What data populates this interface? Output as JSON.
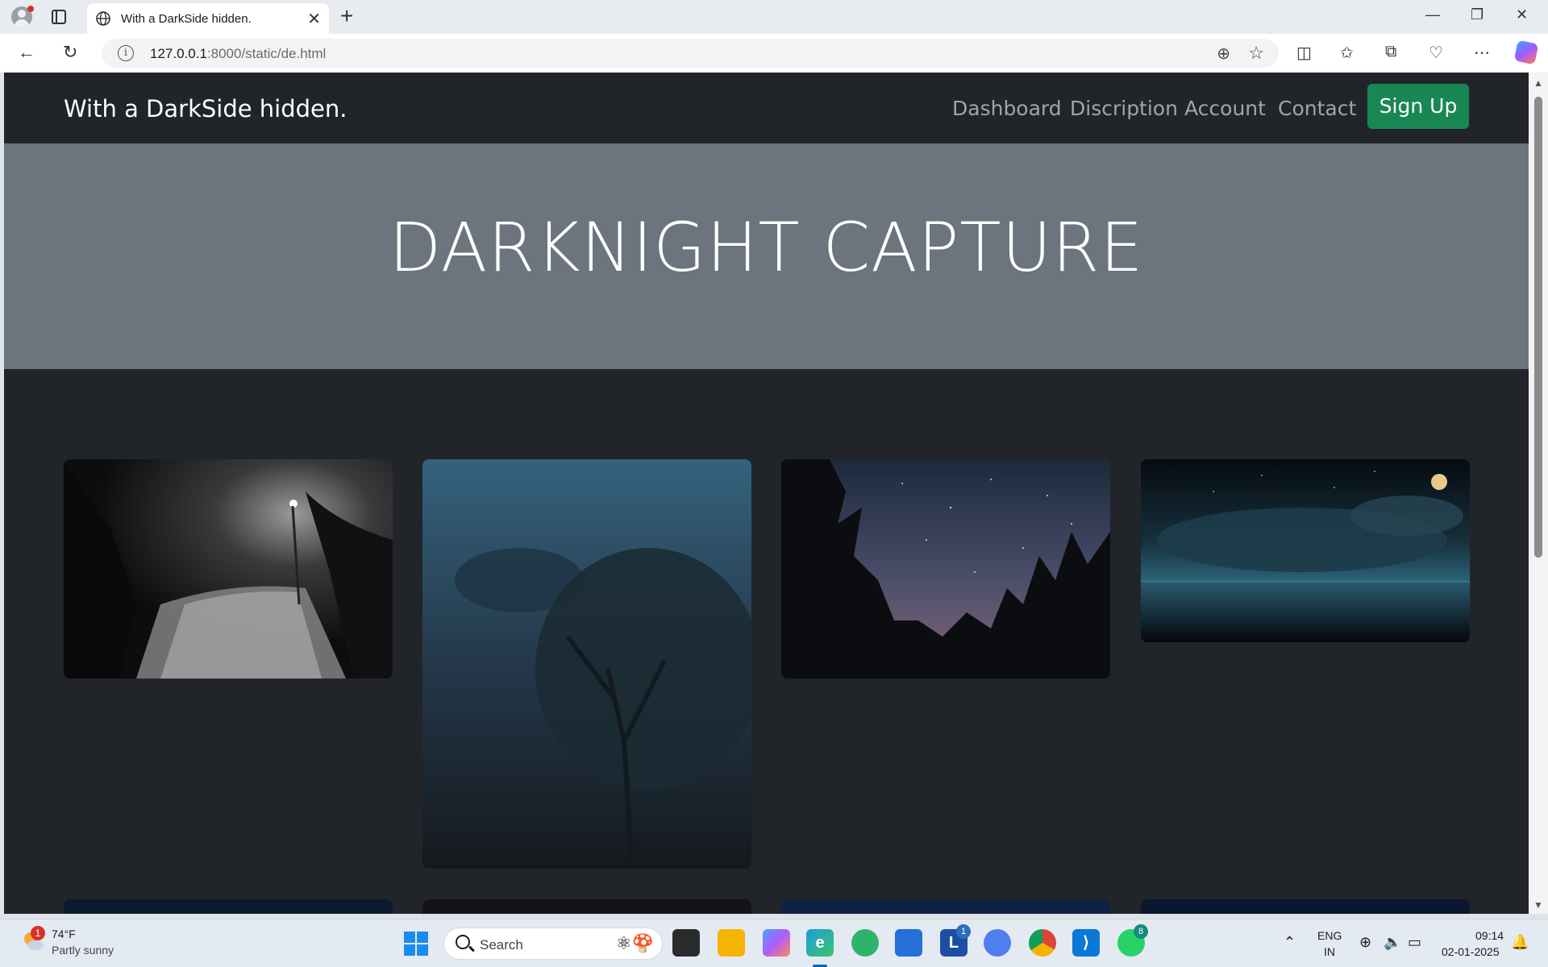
{
  "browser": {
    "tab_title": "With a DarkSide hidden.",
    "url_host": "127.0.0.1",
    "url_rest": ":8000/static/de.html",
    "new_tab": "+",
    "tab_close": "✕"
  },
  "navbar": {
    "brand": "With a DarkSide hidden.",
    "links": [
      "Dashboard",
      "Discription",
      "Account",
      "Contact"
    ],
    "signup": "Sign Up"
  },
  "hero": {
    "title": "DARKNIGHT CAPTURE"
  },
  "gallery": {
    "photos": [
      "foggy-street-lamp-road",
      "misty-blue-tree",
      "starry-sky-pine-forest",
      "moonlit-clouds-over-sea"
    ]
  },
  "taskbar": {
    "weather_temp": "74°F",
    "weather_desc": "Partly sunny",
    "weather_badge": "1",
    "search_label": "Search",
    "lang_1": "ENG",
    "lang_2": "IN",
    "time": "09:14",
    "date": "02-01-2025",
    "badge_l": "1",
    "badge_whatsapp": "8"
  },
  "colors": {
    "page_bg": "#212529",
    "hero_bg": "#6c757d",
    "signup_bg": "#198754",
    "nav_link": "rgba(255,255,255,0.58)"
  }
}
